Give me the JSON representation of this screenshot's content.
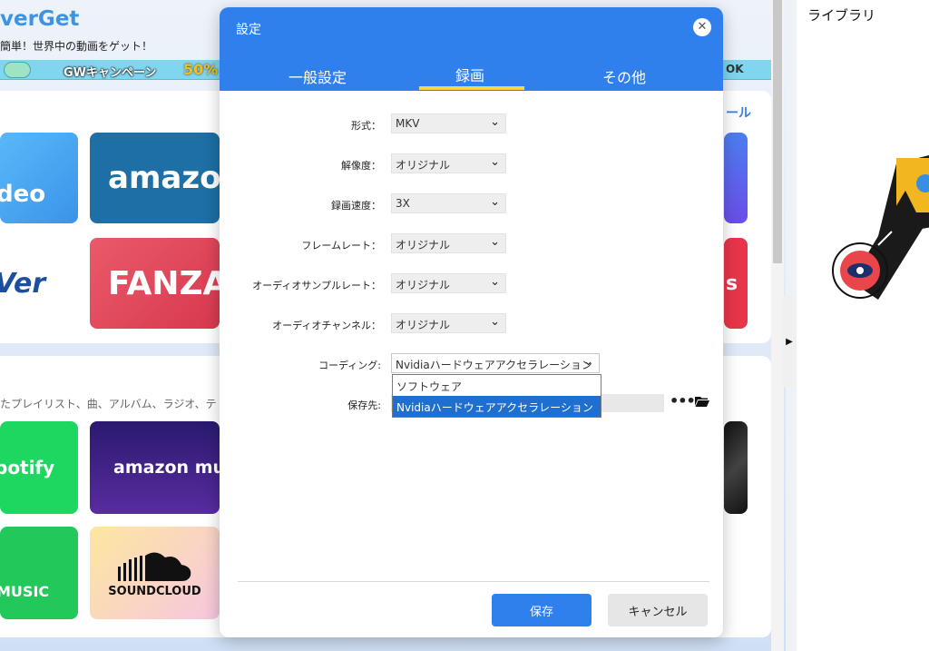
{
  "app": {
    "brand": "verGet",
    "tagline": "簡単！世界中の動画をゲット！",
    "banner": {
      "text": "GWキャンペーン",
      "percent": "50%",
      "right_text": "OK"
    },
    "section_link": "ール",
    "section_desc": "たプレイリスト、曲、アルバム、ラジオ、テ",
    "tiles": [
      {
        "label": "deo",
        "color": "#49a7f4"
      },
      {
        "label": "amazon",
        "color": "#1d6fa5"
      },
      {
        "label": "Ver",
        "color": "#ffffff"
      },
      {
        "label": "FANZA",
        "color": "#e14b5c"
      },
      {
        "label": "s",
        "color": "#e8354a"
      },
      {
        "label": "potify",
        "color": "#1ed760"
      },
      {
        "label": "amazon music",
        "color": "#3b2a8a"
      },
      {
        "label": "MUSIC",
        "color": "#23c85a"
      },
      {
        "label": "SOUNDCLOUD",
        "color": "#f7d9e6"
      }
    ]
  },
  "library": {
    "title": "ライブラリ"
  },
  "dialog": {
    "title": "設定",
    "close_icon": "close-icon",
    "tabs": [
      {
        "label": "一般設定",
        "active": false
      },
      {
        "label": "録画",
        "active": true
      },
      {
        "label": "その他",
        "active": false
      }
    ],
    "rows": [
      {
        "label": "形式：",
        "value": "MKV"
      },
      {
        "label": "解像度：",
        "value": "オリジナル"
      },
      {
        "label": "録画速度：",
        "value": "3X"
      },
      {
        "label": "フレームレート：",
        "value": "オリジナル"
      },
      {
        "label": "オーディオサンプルレート：",
        "value": "オリジナル"
      },
      {
        "label": "オーディオチャンネル：",
        "value": "オリジナル"
      }
    ],
    "coding": {
      "label": "コーディング:",
      "value": "Nvidiaハードウェアアクセラレーション",
      "options": [
        "ソフトウェア",
        "Nvidiaハードウェアアクセラレーション"
      ],
      "selected_index": 1
    },
    "save_path": {
      "label": "保存先:",
      "value": "",
      "browse_label": "•••"
    },
    "buttons": {
      "save": "保存",
      "cancel": "キャンセル"
    },
    "accent_color": "#2f80ed"
  }
}
